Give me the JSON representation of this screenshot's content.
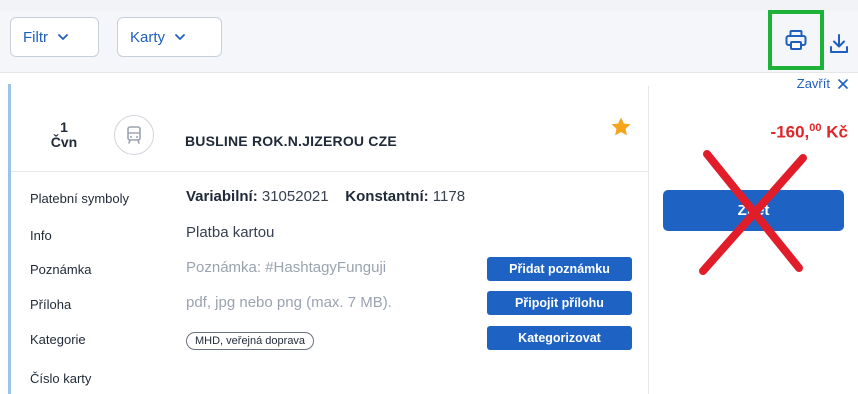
{
  "toolbar": {
    "filter_label": "Filtr",
    "cards_label": "Karty",
    "accent_color": "#1f5fbf",
    "print_icon": "printer-icon",
    "download_icon": "download-icon"
  },
  "panel": {
    "close_label": "Zavřít",
    "close_icon": "close-icon"
  },
  "transaction": {
    "day": "1",
    "month": "Čvn",
    "merchant": "BUSLINE ROK.N.JIZEROU CZE",
    "category_icon": "bus-icon",
    "favorite_icon": "star-icon",
    "amount_main": "-160,",
    "amount_decimal": "00",
    "amount_currency": "Kč",
    "amount_color": "#e0252b"
  },
  "action": {
    "button_label": "Zpět"
  },
  "details": {
    "symbols_label": "Platební symboly",
    "variable_key": "Variabilní:",
    "variable_value": "31052021",
    "constant_key": "Konstantní:",
    "constant_value": "1178",
    "info_label": "Info",
    "info_value": "Platba kartou",
    "note_label": "Poznámka",
    "note_placeholder": "Poznámka: #HashtagyFunguji",
    "note_button": "Přidat poznámku",
    "attachment_label": "Příloha",
    "attachment_placeholder": "pdf, jpg nebo png (max. 7 MB).",
    "attachment_button": "Připojit přílohu",
    "category_label": "Kategorie",
    "category_tag": "MHD, veřejná doprava",
    "category_button": "Kategorizovat",
    "card_number_label": "Číslo karty"
  }
}
